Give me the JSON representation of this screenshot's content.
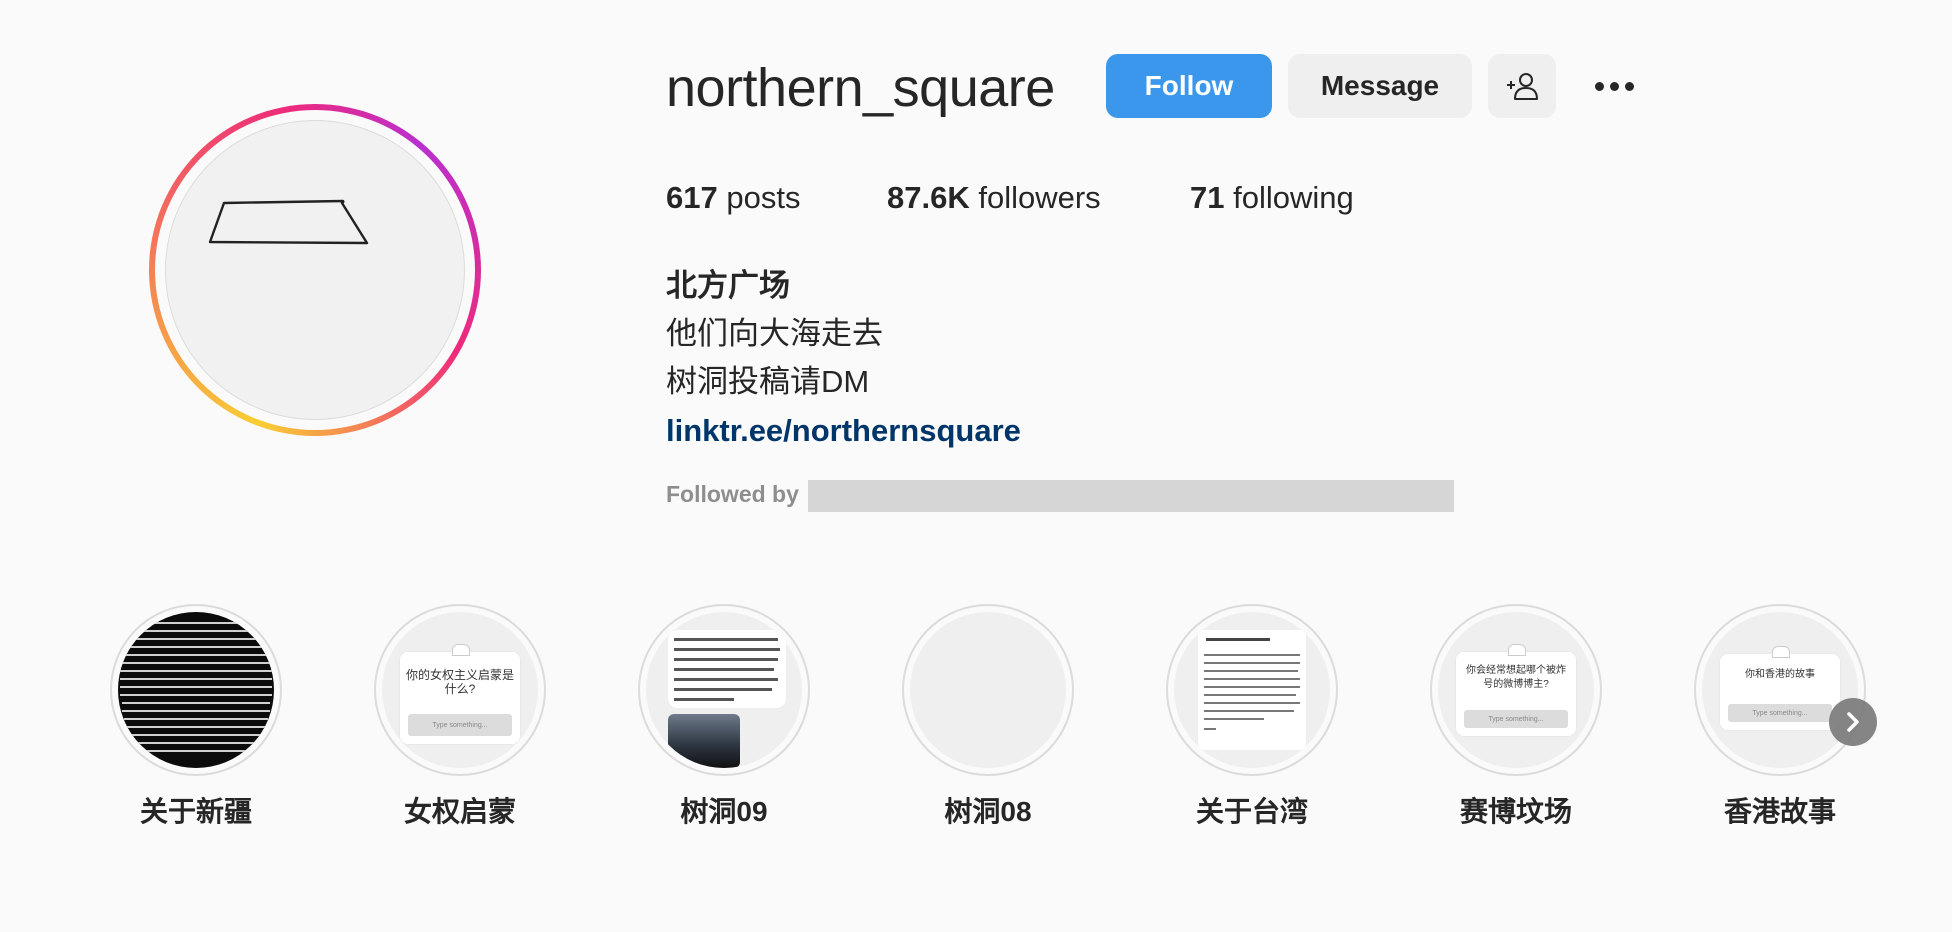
{
  "profile": {
    "username": "northern_square",
    "follow_label": "Follow",
    "message_label": "Message",
    "suggest_icon": "add-person-icon",
    "more_icon": "more-options-icon"
  },
  "stats": {
    "posts_count": "617",
    "posts_label": "posts",
    "followers_count": "87.6K",
    "followers_label": "followers",
    "following_count": "71",
    "following_label": "following"
  },
  "bio": {
    "full_name": "北方广场",
    "line1": "他们向大海走去",
    "line2": "树洞投稿请DM",
    "link": "linktr.ee/northernsquare",
    "followed_by_label": "Followed by"
  },
  "highlights": [
    {
      "label": "关于新疆"
    },
    {
      "label": "女权启蒙",
      "card_title": "你的女权主义启蒙是什么?",
      "card_placeholder": "Type something..."
    },
    {
      "label": "树洞09"
    },
    {
      "label": "树洞08"
    },
    {
      "label": "关于台湾"
    },
    {
      "label": "赛博坟场",
      "card_title": "你会经常想起哪个被炸号的微博博主?",
      "card_placeholder": "Type something..."
    },
    {
      "label": "香港故事",
      "card_title": "你和香港的故事",
      "card_placeholder": "Type something..."
    }
  ],
  "colors": {
    "follow_button": "#3b97ec",
    "link": "#003569",
    "muted_text": "#8e8e8e",
    "background": "#fafafa"
  }
}
